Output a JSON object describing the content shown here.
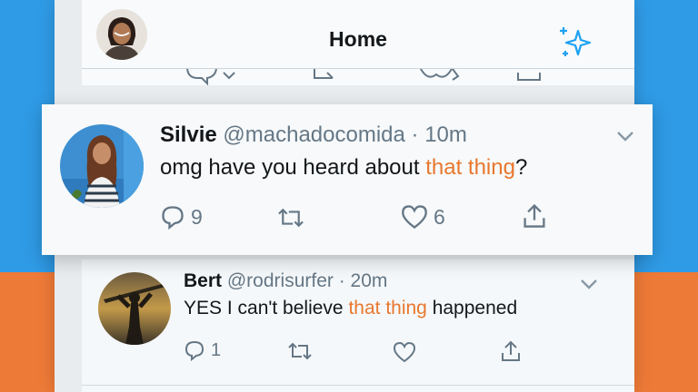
{
  "colors": {
    "background_top": "#2f9be6",
    "background_bottom": "#ee7a37",
    "accent": "#1da1f2",
    "highlight": "#e8772e",
    "text_primary": "#14171a",
    "text_secondary": "#657786"
  },
  "header": {
    "title": "Home",
    "avatar_icon": "profile-avatar",
    "sparkle_icon": "sparkle-icon"
  },
  "tweets": [
    {
      "name": "Silvie",
      "handle": "@machadocomida",
      "time": "10m",
      "text_before": "omg have you heard about ",
      "text_highlight": "that thing",
      "text_after": "?",
      "reply_count": "9",
      "retweet_count": "",
      "like_count": "6"
    },
    {
      "name": "Bert",
      "handle": "@rodrisurfer",
      "time": "20m",
      "text_before": "YES I can't believe ",
      "text_highlight": "that thing",
      "text_after": " happened",
      "reply_count": "1",
      "retweet_count": "",
      "like_count": ""
    }
  ],
  "separator": " · "
}
